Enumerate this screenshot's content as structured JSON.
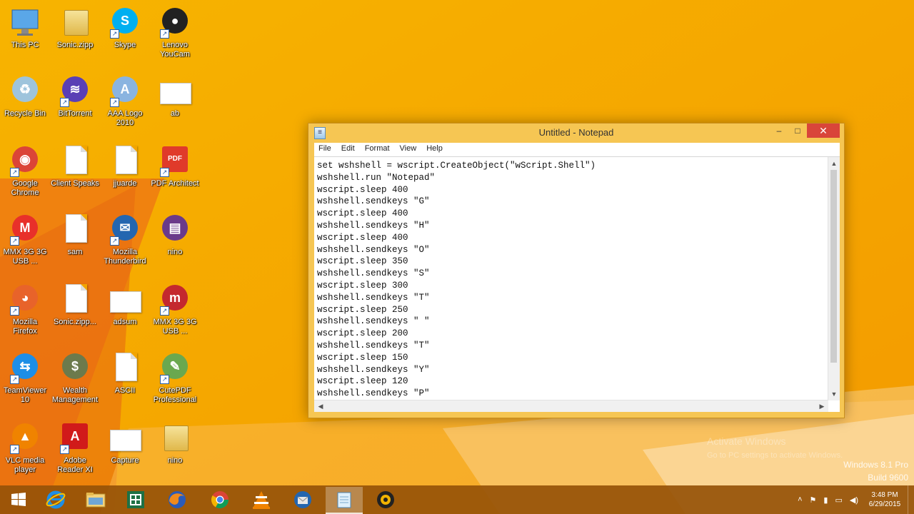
{
  "desktop": {
    "icons": [
      {
        "label": "This PC"
      },
      {
        "label": "Sonic.zipp"
      },
      {
        "label": "Skype"
      },
      {
        "label": "Lenovo YouCam"
      },
      {
        "label": "Recycle Bin"
      },
      {
        "label": "BitTorrent"
      },
      {
        "label": "AAA Logo 2010"
      },
      {
        "label": "ab"
      },
      {
        "label": "Google Chrome"
      },
      {
        "label": "Client Speaks"
      },
      {
        "label": "jjuarde"
      },
      {
        "label": "PDF Architect"
      },
      {
        "label": "MMX 3G 3G USB ..."
      },
      {
        "label": "sam"
      },
      {
        "label": "Mozilla Thunderbird"
      },
      {
        "label": "nino"
      },
      {
        "label": "Mozilla Firefox"
      },
      {
        "label": "Sonic.zipp..."
      },
      {
        "label": "adsum"
      },
      {
        "label": "MMX 3G 3G USB ..."
      },
      {
        "label": "TeamViewer 10"
      },
      {
        "label": "Wealth Management"
      },
      {
        "label": "ASCII"
      },
      {
        "label": "CutePDF Professional"
      },
      {
        "label": "VLC media player"
      },
      {
        "label": "Adobe Reader XI"
      },
      {
        "label": "Capture"
      },
      {
        "label": "nino"
      }
    ]
  },
  "notepad": {
    "title": "Untitled - Notepad",
    "controls": {
      "minimize": "–",
      "maximize": "□",
      "close": "✕"
    },
    "menu": [
      "File",
      "Edit",
      "Format",
      "View",
      "Help"
    ],
    "content": "set wshshell = wscript.CreateObject(\"wScript.Shell\")\nwshshell.run \"Notepad\"\nwscript.sleep 400\nwshshell.sendkeys \"G\"\nwscript.sleep 400\nwshshell.sendkeys \"H\"\nwscript.sleep 400\nwshshell.sendkeys \"O\"\nwscript.sleep 350\nwshshell.sendkeys \"S\"\nwscript.sleep 300\nwshshell.sendkeys \"T\"\nwscript.sleep 250\nwshshell.sendkeys \" \"\nwscript.sleep 200\nwshshell.sendkeys \"T\"\nwscript.sleep 150\nwshshell.sendkeys \"Y\"\nwscript.sleep 120\nwshshell.sendkeys \"P\""
  },
  "watermark": {
    "line1": "Activate Windows",
    "line2": "Go to PC settings to activate Windows."
  },
  "edition": {
    "line1": "Windows 8.1 Pro",
    "line2": "Build 9600"
  },
  "taskbar": {
    "items": [
      "start-button",
      "internet-explorer",
      "file-explorer",
      "excel",
      "firefox",
      "chrome",
      "vlc",
      "thunderbird",
      "notepad",
      "lenovo-youcam"
    ],
    "active_index": 8
  },
  "tray": {
    "chevron": "˄",
    "time": "3:48 PM",
    "date": "6/29/2015"
  },
  "colors": {
    "wallpaper": "#f3a400",
    "taskbar": "#96520a",
    "close_button": "#d9453a"
  }
}
